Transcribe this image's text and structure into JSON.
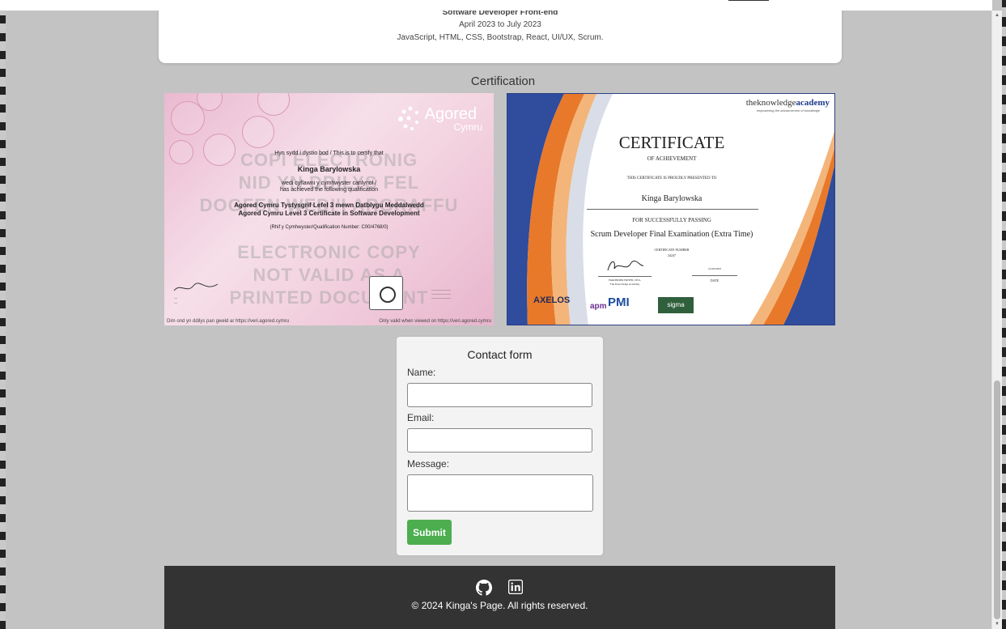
{
  "experience": {
    "title": "Software Developer Front-end",
    "dates": "April 2023 to July 2023",
    "skills": "JavaScript, HTML, CSS, Bootstrap, React, UI/UX, Scrum."
  },
  "certification": {
    "heading": "Certification",
    "agored": {
      "logo_name": "Agored",
      "logo_sub": "Cymru",
      "certify_line": "Hyn sydd i dystio bod / This is to certify that",
      "recipient": "Kinga Barylowska",
      "achieved_line1": "wedi cyflawni y cymhwyster canlynol /",
      "achieved_line2": "has achieved the following qualification",
      "qualification_cy": "Agored Cymru Tystysgrif Lefel 3 mewn Datblygu Meddalwedd",
      "qualification_en": "Agored Cymru Level 3 Certificate in Software Development",
      "qual_number": "(Rhif y Cymhwyster/Qualification Number: C00/4768/0)",
      "watermark_1": "COPI ELECTRONIG",
      "watermark_2": "NID YN DDILYS FEL",
      "watermark_3": "DOGFEN WEDI'I ARGRAFFU",
      "watermark_4": "ELECTRONIC COPY",
      "watermark_5": "NOT VALID AS A",
      "watermark_6": "PRINTED DOCUMENT",
      "footer_left": "Dim ond yn ddilys pan gweld ar https://veri.agored.cymru",
      "footer_right": "Only valid when viewed on https://veri.agored.cymru"
    },
    "knowledge_academy": {
      "logo_prefix": "theknowledge",
      "logo_suffix": "academy",
      "tagline": "empowering the advancement of knowledge",
      "title": "CERTIFICATE",
      "subtitle": "OF ACHIEVEMENT",
      "presented": "THIS CERTIFICATE IS PROUDLY PRESENTED TO",
      "recipient": "Kinga Barylowska",
      "passing": "FOR SUCCESSFULLY PASSING",
      "exam": "Scrum Developer Final Examination (Extra Time)",
      "cert_number_label": "CERTIFICATE NUMBER",
      "cert_number": "24247",
      "signer": "HARINDER HOTHI, CEO,",
      "signer_org": "The Knowledge Academy",
      "date_value": "21/09/2023",
      "date_label": "DATE",
      "logos": [
        "AXELOS",
        "apm",
        "PMI",
        "sigma"
      ]
    }
  },
  "contact_form": {
    "title": "Contact form",
    "name_label": "Name:",
    "email_label": "Email:",
    "message_label": "Message:",
    "name_value": "",
    "email_value": "",
    "message_value": "",
    "submit_label": "Submit"
  },
  "footer": {
    "copyright": "© 2024 Kinga's Page. All rights reserved.",
    "icons": [
      "github-icon",
      "linkedin-icon"
    ]
  },
  "colors": {
    "page_bg": "#c3c3c3",
    "submit_green": "#4cae4f",
    "footer_bg": "#333333"
  }
}
